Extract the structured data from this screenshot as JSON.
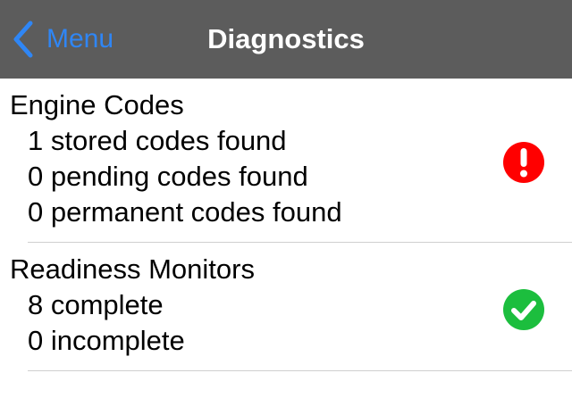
{
  "header": {
    "back_label": "Menu",
    "title": "Diagnostics",
    "back_icon": "chevron-left-icon"
  },
  "engine_codes": {
    "title": "Engine Codes",
    "lines": [
      "1 stored codes found",
      "0 pending codes found",
      "0 permanent codes found"
    ],
    "status_icon": "error-icon",
    "status_color": "#ff0000"
  },
  "readiness_monitors": {
    "title": "Readiness Monitors",
    "lines": [
      "8 complete",
      "0 incomplete"
    ],
    "status_icon": "check-circle-icon",
    "status_color": "#1cbe3e"
  },
  "colors": {
    "navbar": "#5c5c5c",
    "accent": "#2f86f5"
  }
}
